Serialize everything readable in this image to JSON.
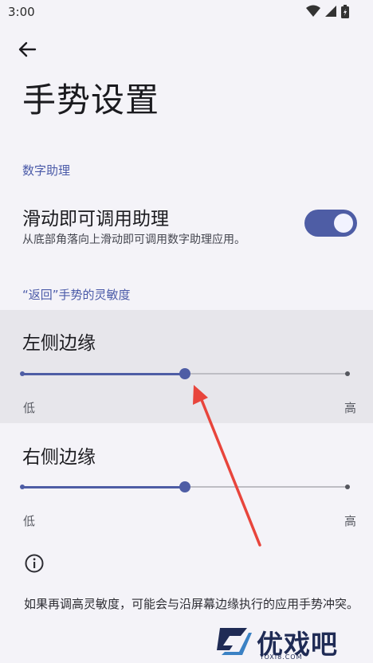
{
  "status_bar": {
    "time": "3:00",
    "icons": [
      "wifi-icon",
      "signal-icon",
      "battery-icon"
    ]
  },
  "header": {
    "back_icon": "arrow-left-icon",
    "title": "手势设置"
  },
  "digital_assistant": {
    "section_label": "数字助理",
    "swipe_item": {
      "title": "滑动即可调用助理",
      "subtitle": "从底部角落向上滑动即可调用数字助理应用。",
      "enabled": true
    }
  },
  "back_sensitivity": {
    "section_label": "“返回”手势的灵敏度",
    "left_edge": {
      "title": "左侧边缘",
      "min_label": "低",
      "max_label": "高",
      "level": 0.5
    },
    "right_edge": {
      "title": "右侧边缘",
      "min_label": "低",
      "max_label": "高",
      "level": 0.5
    }
  },
  "info": {
    "icon": "info-icon",
    "text": "如果再调高灵敏度，可能会与沿屏幕边缘执行的应用手势冲突。"
  },
  "watermark": {
    "text": "优戏吧",
    "sub": "YOXI8.COM"
  },
  "colors": {
    "accent": "#4e5da5",
    "background": "#f4f3f8",
    "annotation_arrow": "#e8453c"
  }
}
